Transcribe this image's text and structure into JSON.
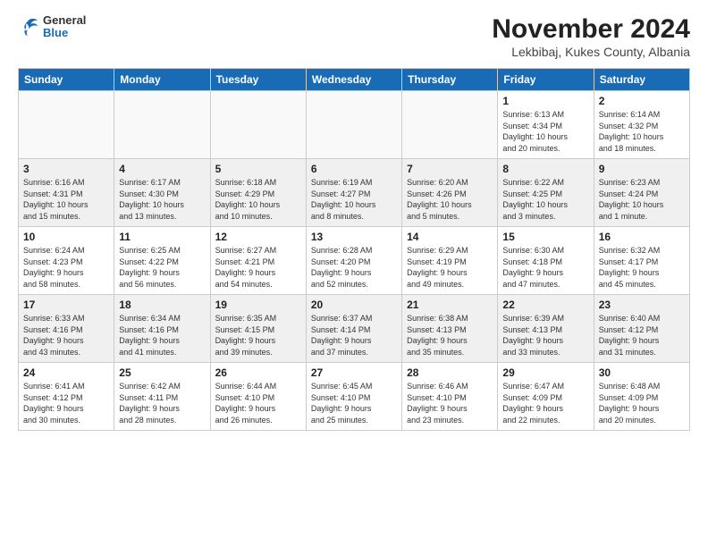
{
  "header": {
    "logo": {
      "general": "General",
      "blue": "Blue"
    },
    "title": "November 2024",
    "subtitle": "Lekbibaj, Kukes County, Albania"
  },
  "weekdays": [
    "Sunday",
    "Monday",
    "Tuesday",
    "Wednesday",
    "Thursday",
    "Friday",
    "Saturday"
  ],
  "weeks": [
    [
      {
        "day": "",
        "info": ""
      },
      {
        "day": "",
        "info": ""
      },
      {
        "day": "",
        "info": ""
      },
      {
        "day": "",
        "info": ""
      },
      {
        "day": "",
        "info": ""
      },
      {
        "day": "1",
        "info": "Sunrise: 6:13 AM\nSunset: 4:34 PM\nDaylight: 10 hours\nand 20 minutes."
      },
      {
        "day": "2",
        "info": "Sunrise: 6:14 AM\nSunset: 4:32 PM\nDaylight: 10 hours\nand 18 minutes."
      }
    ],
    [
      {
        "day": "3",
        "info": "Sunrise: 6:16 AM\nSunset: 4:31 PM\nDaylight: 10 hours\nand 15 minutes."
      },
      {
        "day": "4",
        "info": "Sunrise: 6:17 AM\nSunset: 4:30 PM\nDaylight: 10 hours\nand 13 minutes."
      },
      {
        "day": "5",
        "info": "Sunrise: 6:18 AM\nSunset: 4:29 PM\nDaylight: 10 hours\nand 10 minutes."
      },
      {
        "day": "6",
        "info": "Sunrise: 6:19 AM\nSunset: 4:27 PM\nDaylight: 10 hours\nand 8 minutes."
      },
      {
        "day": "7",
        "info": "Sunrise: 6:20 AM\nSunset: 4:26 PM\nDaylight: 10 hours\nand 5 minutes."
      },
      {
        "day": "8",
        "info": "Sunrise: 6:22 AM\nSunset: 4:25 PM\nDaylight: 10 hours\nand 3 minutes."
      },
      {
        "day": "9",
        "info": "Sunrise: 6:23 AM\nSunset: 4:24 PM\nDaylight: 10 hours\nand 1 minute."
      }
    ],
    [
      {
        "day": "10",
        "info": "Sunrise: 6:24 AM\nSunset: 4:23 PM\nDaylight: 9 hours\nand 58 minutes."
      },
      {
        "day": "11",
        "info": "Sunrise: 6:25 AM\nSunset: 4:22 PM\nDaylight: 9 hours\nand 56 minutes."
      },
      {
        "day": "12",
        "info": "Sunrise: 6:27 AM\nSunset: 4:21 PM\nDaylight: 9 hours\nand 54 minutes."
      },
      {
        "day": "13",
        "info": "Sunrise: 6:28 AM\nSunset: 4:20 PM\nDaylight: 9 hours\nand 52 minutes."
      },
      {
        "day": "14",
        "info": "Sunrise: 6:29 AM\nSunset: 4:19 PM\nDaylight: 9 hours\nand 49 minutes."
      },
      {
        "day": "15",
        "info": "Sunrise: 6:30 AM\nSunset: 4:18 PM\nDaylight: 9 hours\nand 47 minutes."
      },
      {
        "day": "16",
        "info": "Sunrise: 6:32 AM\nSunset: 4:17 PM\nDaylight: 9 hours\nand 45 minutes."
      }
    ],
    [
      {
        "day": "17",
        "info": "Sunrise: 6:33 AM\nSunset: 4:16 PM\nDaylight: 9 hours\nand 43 minutes."
      },
      {
        "day": "18",
        "info": "Sunrise: 6:34 AM\nSunset: 4:16 PM\nDaylight: 9 hours\nand 41 minutes."
      },
      {
        "day": "19",
        "info": "Sunrise: 6:35 AM\nSunset: 4:15 PM\nDaylight: 9 hours\nand 39 minutes."
      },
      {
        "day": "20",
        "info": "Sunrise: 6:37 AM\nSunset: 4:14 PM\nDaylight: 9 hours\nand 37 minutes."
      },
      {
        "day": "21",
        "info": "Sunrise: 6:38 AM\nSunset: 4:13 PM\nDaylight: 9 hours\nand 35 minutes."
      },
      {
        "day": "22",
        "info": "Sunrise: 6:39 AM\nSunset: 4:13 PM\nDaylight: 9 hours\nand 33 minutes."
      },
      {
        "day": "23",
        "info": "Sunrise: 6:40 AM\nSunset: 4:12 PM\nDaylight: 9 hours\nand 31 minutes."
      }
    ],
    [
      {
        "day": "24",
        "info": "Sunrise: 6:41 AM\nSunset: 4:12 PM\nDaylight: 9 hours\nand 30 minutes."
      },
      {
        "day": "25",
        "info": "Sunrise: 6:42 AM\nSunset: 4:11 PM\nDaylight: 9 hours\nand 28 minutes."
      },
      {
        "day": "26",
        "info": "Sunrise: 6:44 AM\nSunset: 4:10 PM\nDaylight: 9 hours\nand 26 minutes."
      },
      {
        "day": "27",
        "info": "Sunrise: 6:45 AM\nSunset: 4:10 PM\nDaylight: 9 hours\nand 25 minutes."
      },
      {
        "day": "28",
        "info": "Sunrise: 6:46 AM\nSunset: 4:10 PM\nDaylight: 9 hours\nand 23 minutes."
      },
      {
        "day": "29",
        "info": "Sunrise: 6:47 AM\nSunset: 4:09 PM\nDaylight: 9 hours\nand 22 minutes."
      },
      {
        "day": "30",
        "info": "Sunrise: 6:48 AM\nSunset: 4:09 PM\nDaylight: 9 hours\nand 20 minutes."
      }
    ]
  ]
}
